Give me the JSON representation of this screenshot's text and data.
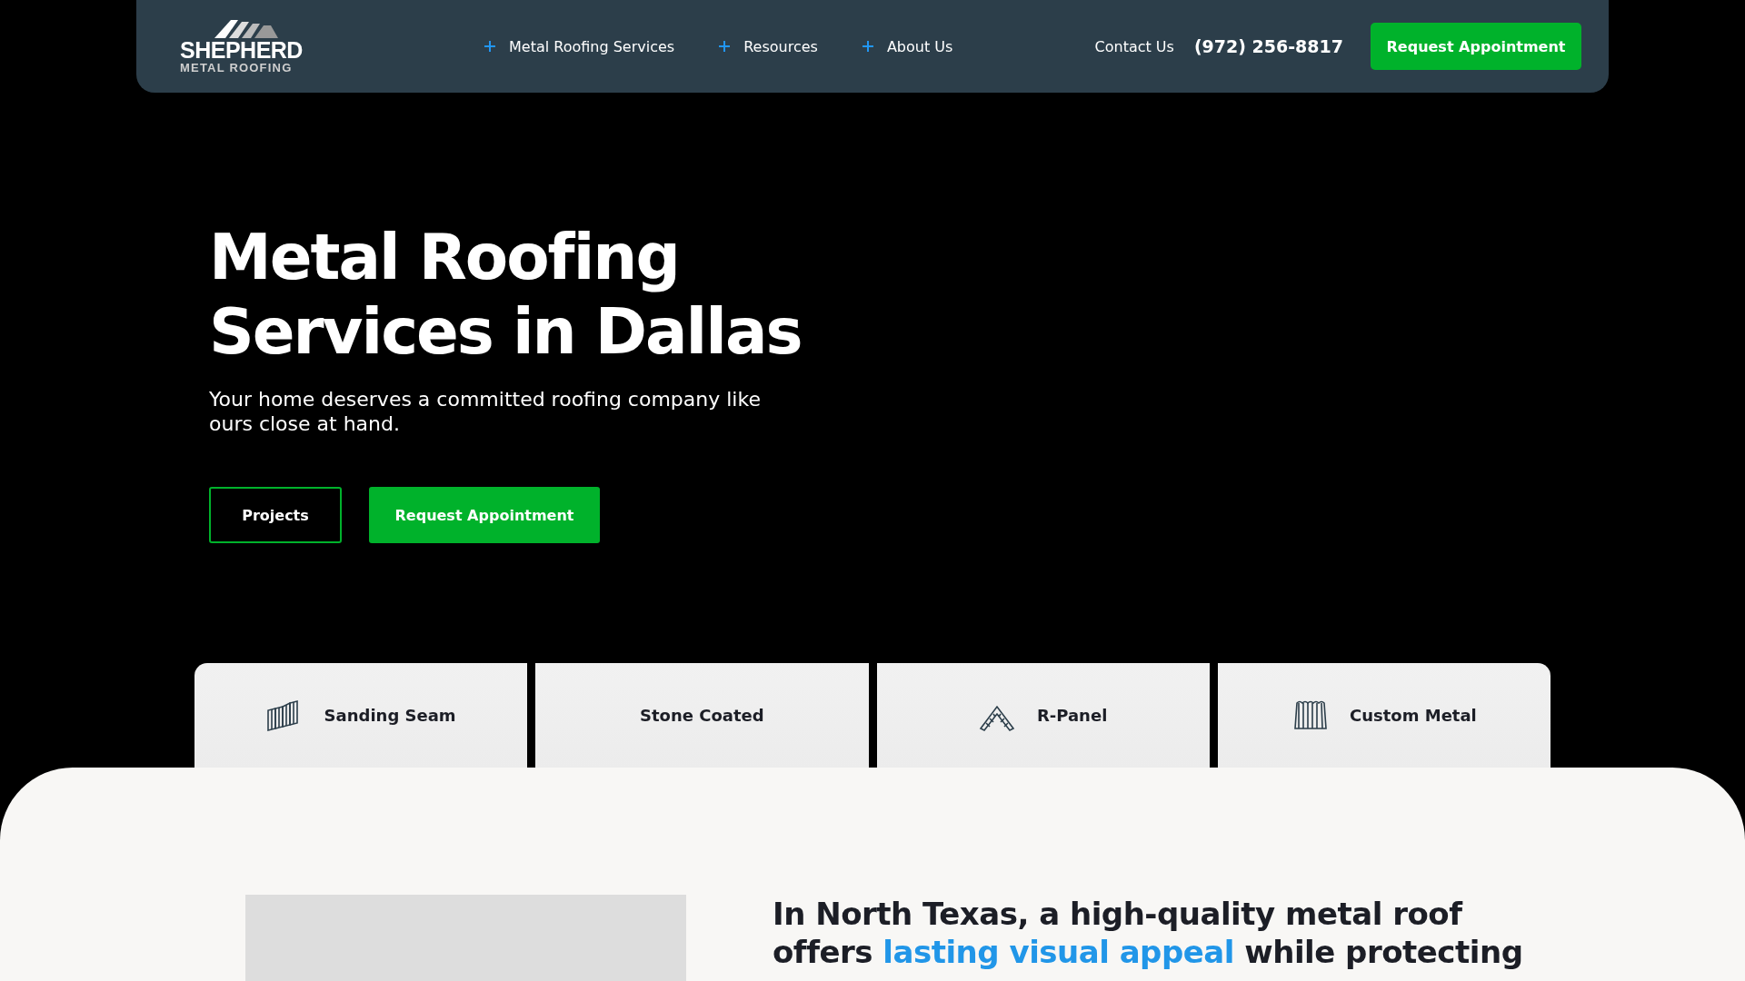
{
  "header": {
    "logo": {
      "name": "SHEPHERD",
      "tagline": "METAL ROOFING"
    },
    "nav": [
      {
        "label": "Metal Roofing Services"
      },
      {
        "label": "Resources"
      },
      {
        "label": "About Us"
      }
    ],
    "contact": "Contact Us",
    "phone_area": "(972)",
    "phone_number": "256-8817",
    "cta": "Request Appointment"
  },
  "hero": {
    "title_lines": [
      "Metal Roofing",
      "Services in Dallas"
    ],
    "subtitle": "Your home deserves a committed roofing company like ours close at hand.",
    "buttons": [
      {
        "label": "Projects",
        "kind": "outline"
      },
      {
        "label": "Request Appointment",
        "kind": "primary"
      }
    ]
  },
  "service_tabs": [
    {
      "label": "Sanding Seam",
      "kind": "seam"
    },
    {
      "label": "Stone Coated",
      "kind": "plain"
    },
    {
      "label": "R-Panel",
      "kind": "peak"
    },
    {
      "label": "Custom Metal",
      "kind": "sheet"
    }
  ],
  "intro": {
    "heading_lines": [
      [
        {
          "text": "In North Texas, a high-quality metal roof",
          "highlight": false
        }
      ],
      [
        {
          "text": "offers ",
          "highlight": false
        },
        {
          "text": "lasting visual appeal",
          "highlight": true
        },
        {
          "text": " while protecting",
          "highlight": false
        }
      ]
    ]
  }
}
